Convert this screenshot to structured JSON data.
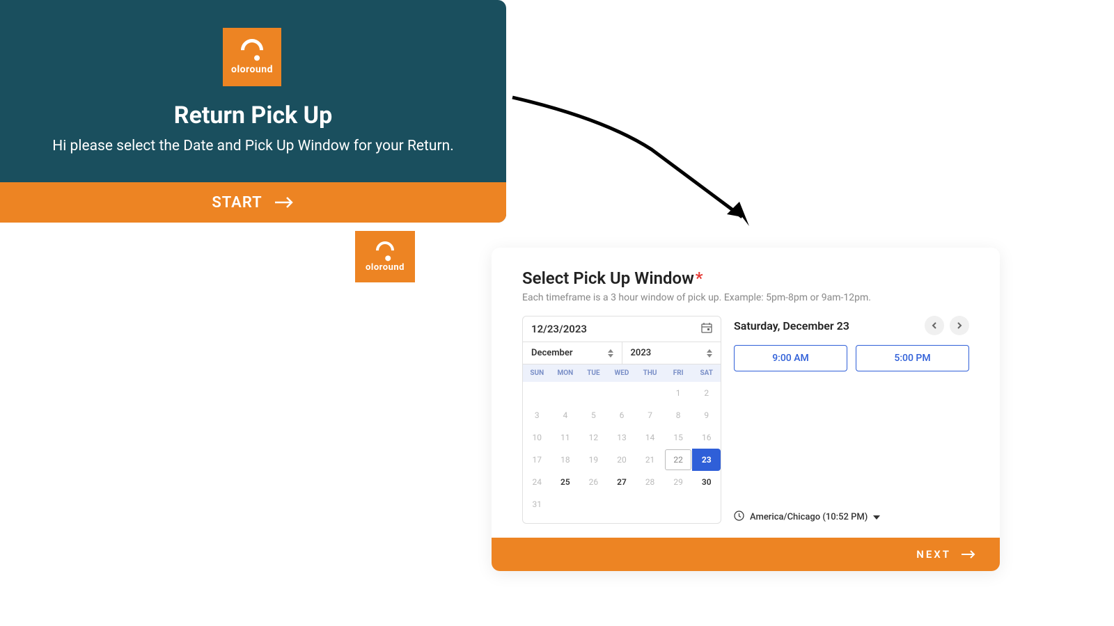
{
  "brand": "oloround",
  "panel1": {
    "title": "Return Pick Up",
    "subtitle": "Hi please select the Date and Pick Up Window for your Return.",
    "start_label": "START"
  },
  "panel2": {
    "title": "Select Pick Up Window",
    "required_marker": "*",
    "subtitle": "Each timeframe is a 3 hour window of pick up. Example: 5pm-8pm or 9am-12pm.",
    "date_input": "12/23/2023",
    "month_label": "December",
    "year_label": "2023",
    "dow": [
      "SUN",
      "MON",
      "TUE",
      "WED",
      "THU",
      "FRI",
      "SAT"
    ],
    "weeks": [
      [
        {
          "n": ""
        },
        {
          "n": ""
        },
        {
          "n": ""
        },
        {
          "n": ""
        },
        {
          "n": ""
        },
        {
          "n": "1"
        },
        {
          "n": "2"
        }
      ],
      [
        {
          "n": "3"
        },
        {
          "n": "4"
        },
        {
          "n": "5"
        },
        {
          "n": "6"
        },
        {
          "n": "7"
        },
        {
          "n": "8"
        },
        {
          "n": "9"
        }
      ],
      [
        {
          "n": "10"
        },
        {
          "n": "11"
        },
        {
          "n": "12"
        },
        {
          "n": "13"
        },
        {
          "n": "14"
        },
        {
          "n": "15"
        },
        {
          "n": "16"
        }
      ],
      [
        {
          "n": "17"
        },
        {
          "n": "18"
        },
        {
          "n": "19"
        },
        {
          "n": "20"
        },
        {
          "n": "21"
        },
        {
          "n": "22",
          "today": true
        },
        {
          "n": "23",
          "sel": true
        }
      ],
      [
        {
          "n": "24"
        },
        {
          "n": "25",
          "avail": true
        },
        {
          "n": "26"
        },
        {
          "n": "27",
          "avail": true
        },
        {
          "n": "28"
        },
        {
          "n": "29"
        },
        {
          "n": "30",
          "avail": true
        }
      ],
      [
        {
          "n": "31"
        },
        {
          "n": ""
        },
        {
          "n": ""
        },
        {
          "n": ""
        },
        {
          "n": ""
        },
        {
          "n": ""
        },
        {
          "n": ""
        }
      ]
    ],
    "selected_date_header": "Saturday, December 23",
    "slots": [
      "9:00 AM",
      "5:00 PM"
    ],
    "timezone": "America/Chicago (10:52 PM)",
    "next_label": "NEXT"
  }
}
